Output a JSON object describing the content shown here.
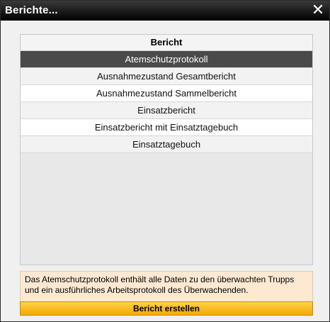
{
  "window": {
    "title": "Berichte..."
  },
  "table": {
    "header": "Bericht",
    "rows": [
      {
        "label": "Atemschutzprotokoll",
        "selected": true
      },
      {
        "label": "Ausnahmezustand Gesamtbericht",
        "selected": false
      },
      {
        "label": "Ausnahmezustand Sammelbericht",
        "selected": false
      },
      {
        "label": "Einsatzbericht",
        "selected": false
      },
      {
        "label": "Einsatzbericht mit Einsatztagebuch",
        "selected": false
      },
      {
        "label": "Einsatztagebuch",
        "selected": false
      }
    ]
  },
  "description": "Das Atemschutzprotokoll enthält alle Daten zu den überwachten Trupps und ein ausführliches Arbeitsprotokoll des Überwachenden.",
  "actions": {
    "create_label": "Bericht erstellen"
  },
  "icons": {
    "close": "close-icon"
  },
  "colors": {
    "selected_row": "#4a4a4a",
    "button": "#f5a800",
    "description_bg": "#fde8d2"
  }
}
